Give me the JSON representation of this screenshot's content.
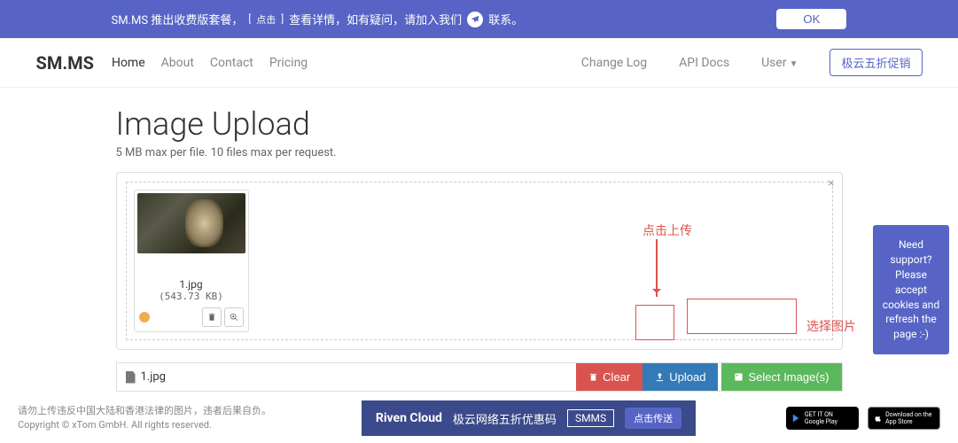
{
  "banner": {
    "prefix": "SM.MS 推出收费版套餐，",
    "bracket_open": "[",
    "click_here": "点击",
    "bracket_close": "]",
    "view_detail": "查看详情，如有疑问，请加入我们",
    "contact": "联系。",
    "ok": "OK"
  },
  "nav": {
    "brand": "SM.MS",
    "home": "Home",
    "about": "About",
    "contact": "Contact",
    "pricing": "Pricing",
    "changelog": "Change Log",
    "apidocs": "API Docs",
    "user": "User",
    "promo": "极云五折促销"
  },
  "page": {
    "title": "Image Upload",
    "subtitle": "5 MB max per file. 10 files max per request."
  },
  "thumb": {
    "name": "1.jpg",
    "size": "(543.73 KB)"
  },
  "filebar": {
    "filename": "1.jpg",
    "clear": "Clear",
    "upload": "Upload",
    "select": "Select Image(s)"
  },
  "annotations": {
    "click_upload": "点击上传",
    "select_image": "选择图片"
  },
  "support": {
    "text": "Need support? Please accept cookies and refresh the page :-)"
  },
  "footer": {
    "line1": "请勿上传违反中国大陆和香港法律的图片，违者后果自负。",
    "line2": "Copyright © xTom GmbH. All rights reserved."
  },
  "riven": {
    "logo": "Riven Cloud",
    "text": "极云网络五折优惠码",
    "badge": "SMMS",
    "btn": "点击传送"
  },
  "stores": {
    "google": "GET IT ON Google Play",
    "apple": "Download on the App Store"
  }
}
